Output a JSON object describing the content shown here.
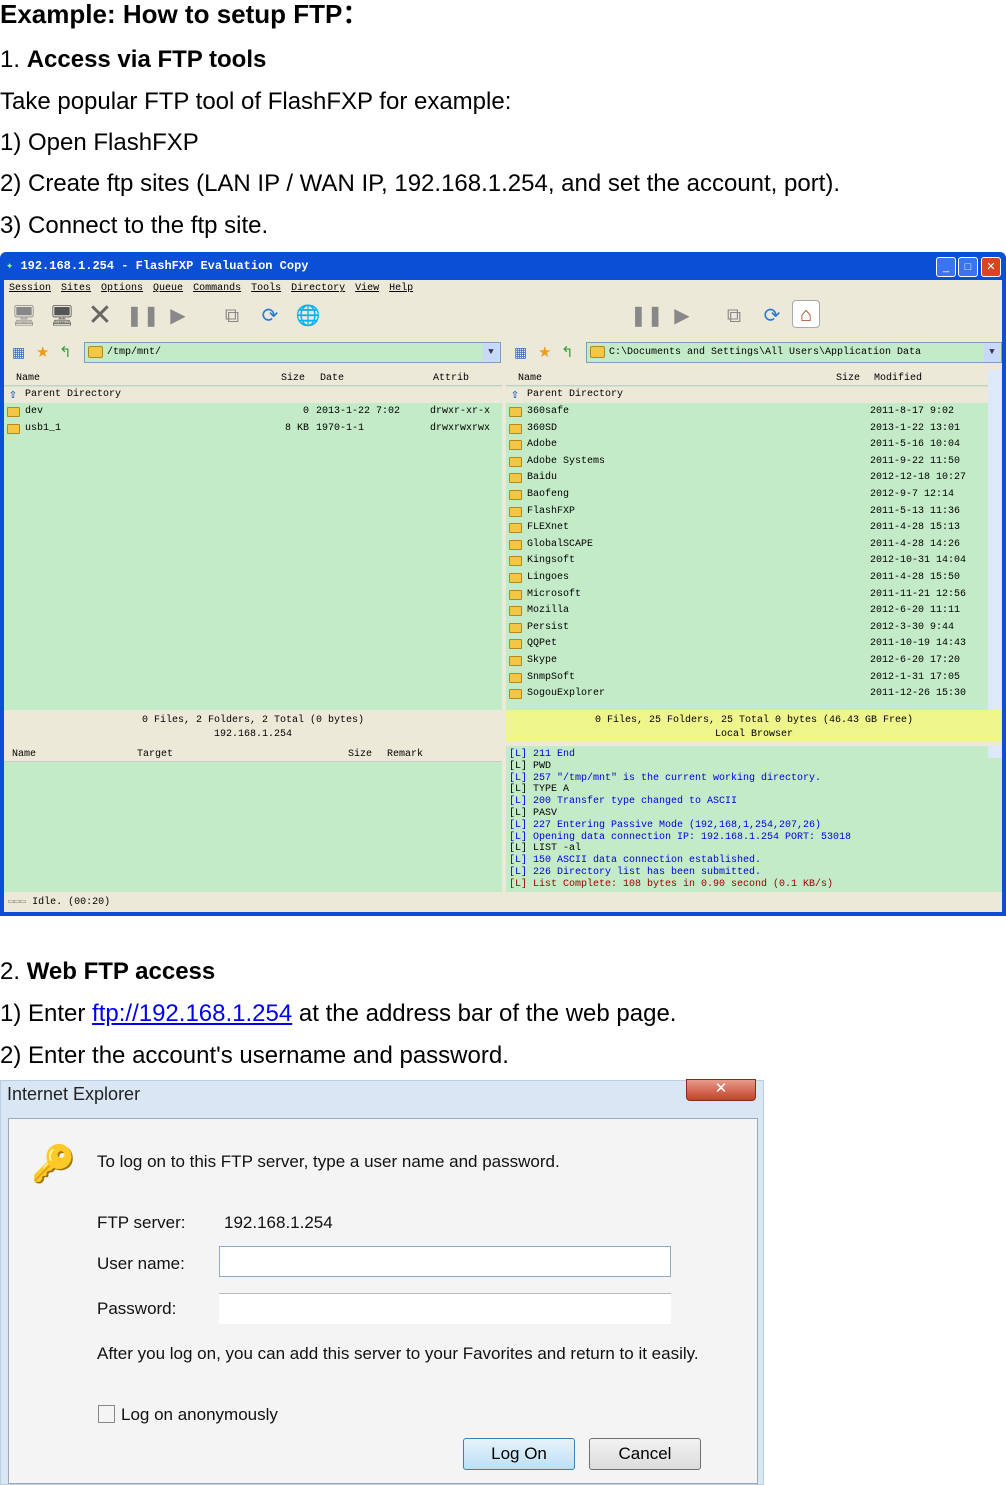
{
  "doc": {
    "title": "Example: How to setup FTP：",
    "section1_num": "1. ",
    "section1_title": "Access via FTP tools",
    "s1_lines": [
      "Take popular FTP tool of FlashFXP for example:",
      "1) Open FlashFXP",
      "2) Create ftp sites (LAN IP / WAN IP, 192.168.1.254, and set the account, port).",
      "3) Connect to the ftp site."
    ],
    "section2_num": "2. ",
    "section2_title": "Web FTP access",
    "s2_line1_pre": "1) Enter ",
    "s2_line1_link": "ftp://192.168.1.254",
    "s2_line1_post": " at the address bar of the web page.",
    "s2_line2": "2) Enter the account's username and password."
  },
  "flashfxp": {
    "title": "192.168.1.254 - FlashFXP Evaluation Copy",
    "menu": [
      "Session",
      "Sites",
      "Options",
      "Queue",
      "Commands",
      "Tools",
      "Directory",
      "View",
      "Help"
    ],
    "remote": {
      "path": "/tmp/mnt/",
      "columns": [
        "Name",
        "Size",
        "Date",
        "Attrib"
      ],
      "parent": "Parent Directory",
      "rows": [
        {
          "name": "dev",
          "size": "0",
          "date": "2013-1-22 7:02",
          "attrib": "drwxr-xr-x"
        },
        {
          "name": "usb1_1",
          "size": "8 KB",
          "date": "1970-1-1",
          "attrib": "drwxrwxrwx"
        }
      ],
      "status1": "0 Files, 2 Folders, 2 Total (0 bytes)",
      "status2": "192.168.1.254"
    },
    "local": {
      "path": "C:\\Documents and Settings\\All Users\\Application Data",
      "columns": [
        "Name",
        "Size",
        "Modified"
      ],
      "parent": "Parent Directory",
      "rows": [
        {
          "name": "360safe",
          "date": "2011-8-17 9:02"
        },
        {
          "name": "360SD",
          "date": "2013-1-22 13:01"
        },
        {
          "name": "Adobe",
          "date": "2011-5-16 10:04"
        },
        {
          "name": "Adobe Systems",
          "date": "2011-9-22 11:50"
        },
        {
          "name": "Baidu",
          "date": "2012-12-18 10:27"
        },
        {
          "name": "Baofeng",
          "date": "2012-9-7 12:14"
        },
        {
          "name": "FlashFXP",
          "date": "2011-5-13 11:36"
        },
        {
          "name": "FLEXnet",
          "date": "2011-4-28 15:13"
        },
        {
          "name": "GlobalSCAPE",
          "date": "2011-4-28 14:26"
        },
        {
          "name": "Kingsoft",
          "date": "2012-10-31 14:04"
        },
        {
          "name": "Lingoes",
          "date": "2011-4-28 15:50"
        },
        {
          "name": "Microsoft",
          "date": "2011-11-21 12:56"
        },
        {
          "name": "Mozilla",
          "date": "2012-6-20 11:11"
        },
        {
          "name": "Persist",
          "date": "2012-3-30 9:44"
        },
        {
          "name": "QQPet",
          "date": "2011-10-19 14:43"
        },
        {
          "name": "Skype",
          "date": "2012-6-20 17:20"
        },
        {
          "name": "SnmpSoft",
          "date": "2012-1-31 17:05"
        },
        {
          "name": "SogouExplorer",
          "date": "2011-12-26 15:30"
        }
      ],
      "status1": "0 Files, 25 Folders, 25 Total 0 bytes (46.43 GB Free)",
      "status2": "Local Browser"
    },
    "queue_columns": [
      "Name",
      "Target",
      "Size",
      "Remark"
    ],
    "log": [
      {
        "t": "[L] 211 End",
        "c": "blue"
      },
      {
        "t": "[L] PWD",
        "c": "blk"
      },
      {
        "t": "[L] 257 \"/tmp/mnt\" is the current working directory.",
        "c": "blue"
      },
      {
        "t": "[L] TYPE A",
        "c": "blk"
      },
      {
        "t": "[L] 200 Transfer type changed to ASCII",
        "c": "blue"
      },
      {
        "t": "[L] PASV",
        "c": "blk"
      },
      {
        "t": "[L] 227 Entering Passive Mode (192,168,1,254,207,26)",
        "c": "blue"
      },
      {
        "t": "[L] Opening data connection IP: 192.168.1.254 PORT: 53018",
        "c": "blue"
      },
      {
        "t": "[L] LIST -al",
        "c": "blk"
      },
      {
        "t": "[L] 150 ASCII data connection established.",
        "c": "blue"
      },
      {
        "t": "[L] 226 Directory list has been submitted.",
        "c": "blue"
      },
      {
        "t": "[L] List Complete: 108 bytes in 0.90 second (0.1 KB/s)",
        "c": "red"
      }
    ],
    "statusbar": "Idle.  (00:20)"
  },
  "ie": {
    "title": "Internet Explorer",
    "prompt": "To log on to this FTP server, type a user name and password.",
    "server_label": "FTP server:",
    "server_value": "192.168.1.254",
    "user_label": "User name:",
    "user_value": "",
    "pass_label": "Password:",
    "note": "After you log on, you can add this server to your Favorites and return to it easily.",
    "anon_label": "Log on anonymously",
    "anon_checked": false,
    "logon": "Log On",
    "cancel": "Cancel"
  }
}
